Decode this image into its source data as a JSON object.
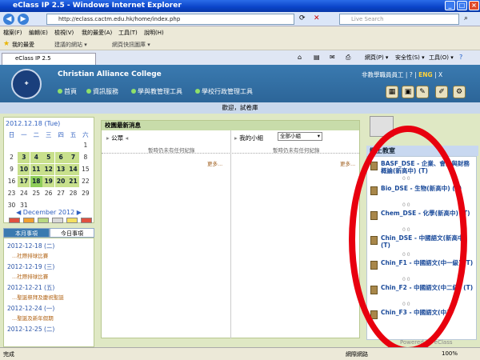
{
  "window": {
    "title": "eClass IP 2.5 - Windows Internet Explorer"
  },
  "address": {
    "url": "http://eclass.cactm.edu.hk/home/index.php",
    "search_placeholder": "Live Search"
  },
  "menus": [
    "檔案(F)",
    "編輯(E)",
    "檢視(V)",
    "我的最愛(A)",
    "工具(T)",
    "說明(H)"
  ],
  "favorites": {
    "label": "我的最愛",
    "item1": "建議的網站 ▾",
    "item2": "網頁快訊圖庫 ▾"
  },
  "tab": {
    "label": "eClass IP 2.5"
  },
  "tools": [
    "網頁(P) ▾",
    "安全性(S) ▾",
    "工具(O) ▾"
  ],
  "school": {
    "name": "Christian Alliance College"
  },
  "nav": [
    "首頁",
    "資訊服務",
    "學與教管理工具",
    "學校行政管理工具"
  ],
  "user": {
    "name": "非教學職員員工",
    "lang": "ENG",
    "lang_sep": "|",
    "help": "?",
    "close": "X"
  },
  "welcome": "歡迎，試卷庫",
  "calendar": {
    "date_label": "2012.12.18 (Tue)",
    "weekdays": [
      "日",
      "一",
      "二",
      "三",
      "四",
      "五",
      "六"
    ],
    "month_label": "December 2012"
  },
  "events": {
    "tab_school": "本月事項",
    "tab_today": "今日事項",
    "items": [
      {
        "date": "2012-12-18 (二)",
        "title": "...社際排球比賽"
      },
      {
        "date": "2012-12-19 (三)",
        "title": "...社際排球比賽"
      },
      {
        "date": "2012-12-21 (五)",
        "title": "...聖誕祭拜及慶祝聖誕"
      },
      {
        "date": "2012-12-24 (一)",
        "title": "...聖誕及新年假期"
      },
      {
        "date": "2012-12-25 (二)",
        "title": ""
      }
    ]
  },
  "notice": {
    "title": "校園最新消息",
    "public_label": "公眾",
    "group_label": "我的小組",
    "group_select": "全部小組",
    "no_record": "暫時仍未有任何紀錄",
    "more": "更多..."
  },
  "classroom": {
    "title": "網上教室",
    "courses": [
      {
        "name": "BASF_DSE - 企業、會計與財務概論(新高中) (T)",
        "stats": "0     0"
      },
      {
        "name": "Bio_DSE - 生物(新高中) (T)",
        "stats": "0     0"
      },
      {
        "name": "Chem_DSE - 化學(新高中) (T)",
        "stats": "0     0"
      },
      {
        "name": "Chin_DSE - 中國語文(新高中) (T)",
        "stats": "0     0"
      },
      {
        "name": "Chin_F1 - 中國語文(中一級) (T)",
        "stats": "0     0"
      },
      {
        "name": "Chin_F2 - 中國語文(中二級) (T)",
        "stats": "0     0"
      },
      {
        "name": "Chin_F3 - 中國語文(中三",
        "stats": ""
      }
    ]
  },
  "footer": {
    "powered": "Powered by eClass"
  },
  "status": {
    "left": "完成",
    "zone": "網際網路",
    "zoom": "100%"
  },
  "colors": {
    "annotation_oval": "#e8000e",
    "header": "#2c6598"
  }
}
